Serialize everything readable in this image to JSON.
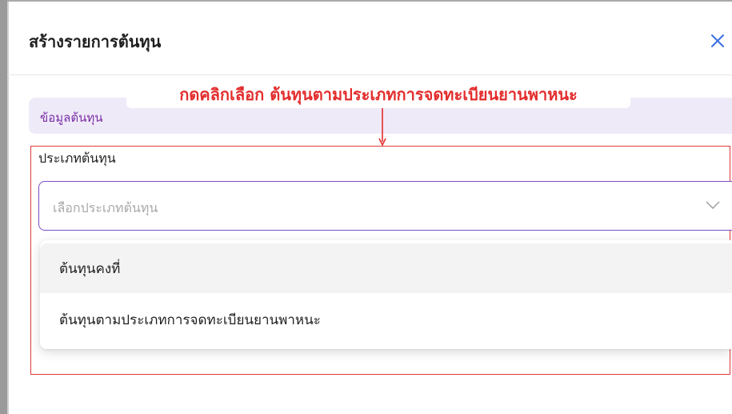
{
  "modal": {
    "title": "สร้างรายการต้นทุน",
    "close_icon": "close-icon"
  },
  "section": {
    "label": "ข้อมูลต้นทุน"
  },
  "annotation": {
    "text": "กดคลิกเลือก ต้นทุนตามประเภทการจดทะเบียนยานพาหนะ",
    "color": "#e32d2d"
  },
  "cost_type": {
    "label": "ประเภทต้นทุน",
    "placeholder": "เลือกประเภทต้นทุน",
    "chevron_icon": "chevron-down-icon",
    "options": [
      {
        "label": "ต้นทุนคงที่"
      },
      {
        "label": "ต้นทุนตามประเภทการจดทะเบียนยานพาหนะ"
      }
    ]
  },
  "colors": {
    "accent": "#7a4fc4",
    "section_bg": "#efeaf8",
    "section_text": "#7a2fa6",
    "close_icon": "#3b6fe0",
    "highlight": "#e03a3a"
  }
}
